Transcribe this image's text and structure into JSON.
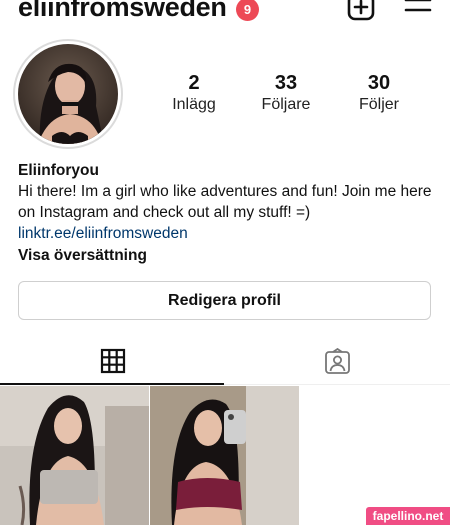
{
  "header": {
    "username": "eliinfromsweden",
    "notification_count": "9",
    "icons": {
      "add": "plus-square-icon",
      "menu": "hamburger-menu-icon"
    }
  },
  "profile": {
    "stats": [
      {
        "value": "2",
        "label": "Inlägg"
      },
      {
        "value": "33",
        "label": "Följare"
      },
      {
        "value": "30",
        "label": "Följer"
      }
    ],
    "display_name": "Eliinforyou",
    "bio": "Hi there! Im a girl who like adventures and fun! Join me here on Instagram and check out all my stuff! =)",
    "link": "linktr.ee/eliinfromsweden",
    "translate_label": "Visa översättning"
  },
  "actions": {
    "edit_profile": "Redigera profil"
  },
  "tabs": [
    {
      "icon": "grid-icon",
      "active": true
    },
    {
      "icon": "tagged-person-icon",
      "active": false
    }
  ],
  "watermark": "fapellino.net",
  "colors": {
    "badge": "#ed4956",
    "link": "#00376b",
    "watermark_bg": "#f04d84"
  }
}
